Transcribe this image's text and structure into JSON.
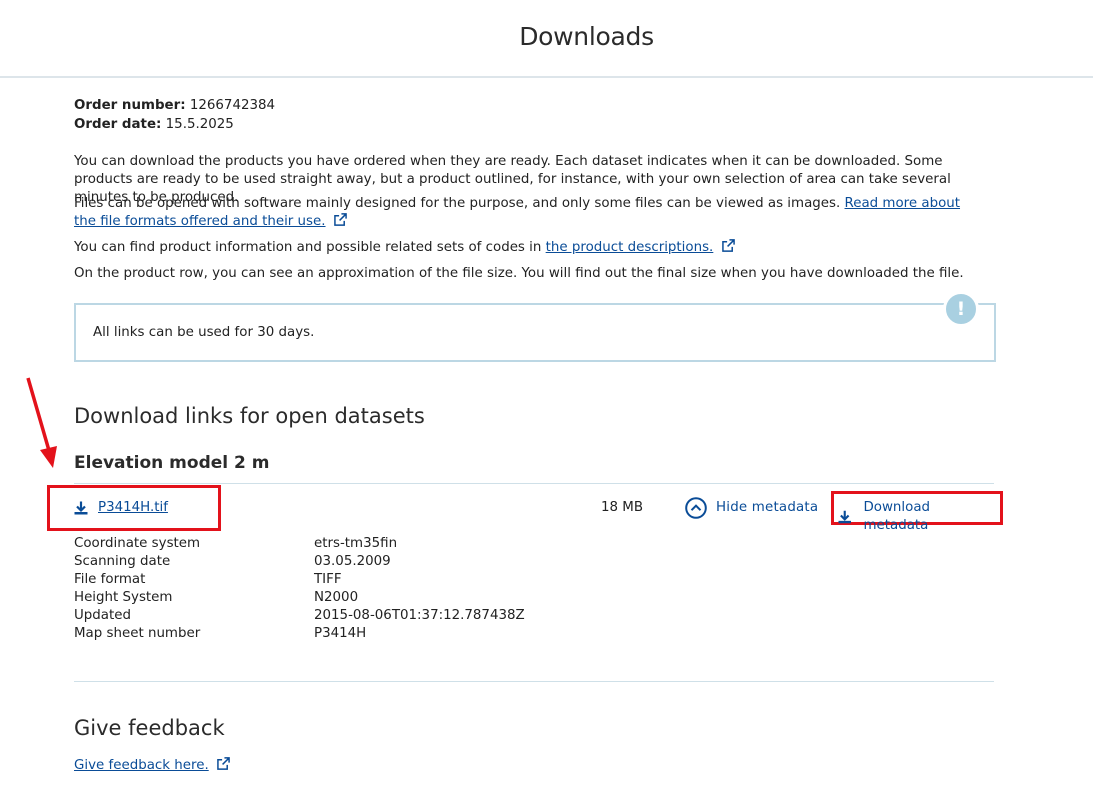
{
  "header": {
    "title": "Downloads"
  },
  "order": {
    "number_label": "Order number:",
    "number_value": "1266742384",
    "date_label": "Order date:",
    "date_value": "15.5.2025"
  },
  "intro": {
    "p1": "You can download the products you have ordered when they are ready. Each dataset indicates when it can be downloaded. Some products are ready to be used straight away, but a product outlined, for instance, with your own selection of area can take several minutes to be produced.",
    "p2_text": "Files can be opened with software mainly designed for the purpose, and only some files can be viewed as images.",
    "p2_link": "Read more about the file formats offered and their use.",
    "p3_text": "You can find product information and possible related sets of codes in",
    "p3_link": "the product descriptions.",
    "p4": "On the product row, you can see an approximation of the file size. You will find out the final size when you have downloaded the file."
  },
  "notice": {
    "text": "All links can be used for 30 days.",
    "icon": "exclamation-icon",
    "icon_glyph": "!"
  },
  "downloads": {
    "heading": "Download links for open datasets",
    "dataset_title": "Elevation model 2 m",
    "file": {
      "name": "P3414H.tif",
      "size": "18 MB",
      "hide_metadata": "Hide metadata",
      "download_metadata": "Download metadata"
    },
    "metadata": [
      {
        "key": "Coordinate system",
        "value": "etrs-tm35fin"
      },
      {
        "key": "Scanning date",
        "value": "03.05.2009"
      },
      {
        "key": "File format",
        "value": "TIFF"
      },
      {
        "key": "Height System",
        "value": "N2000"
      },
      {
        "key": "Updated",
        "value": "2015-08-06T01:37:12.787438Z"
      },
      {
        "key": "Map sheet number",
        "value": "P3414H"
      }
    ]
  },
  "feedback": {
    "heading": "Give feedback",
    "link": "Give feedback here."
  },
  "colors": {
    "link": "#0a4c97",
    "annotation": "#e3121b",
    "notice_border": "#bcd7e4"
  }
}
